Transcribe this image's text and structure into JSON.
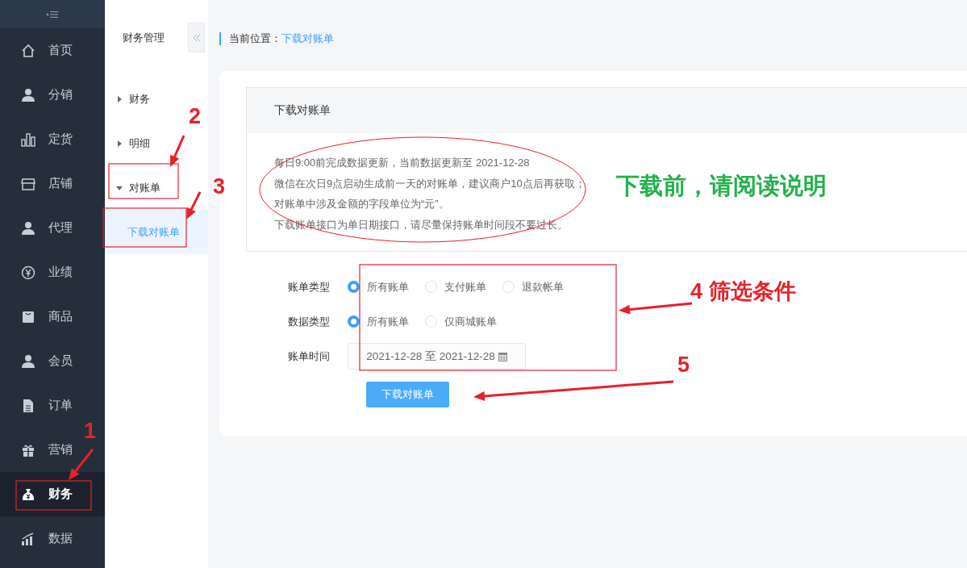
{
  "sidebar": {
    "items": [
      {
        "label": "首页",
        "selected": false
      },
      {
        "label": "分销",
        "selected": false
      },
      {
        "label": "定货",
        "selected": false
      },
      {
        "label": "店铺",
        "selected": false
      },
      {
        "label": "代理",
        "selected": false
      },
      {
        "label": "业绩",
        "selected": false
      },
      {
        "label": "商品",
        "selected": false
      },
      {
        "label": "会员",
        "selected": false
      },
      {
        "label": "订单",
        "selected": false
      },
      {
        "label": "营销",
        "selected": false
      },
      {
        "label": "财务",
        "selected": true
      },
      {
        "label": "数据",
        "selected": false
      }
    ]
  },
  "subnav": {
    "title": "财务管理",
    "tree": [
      {
        "label": "财务",
        "expanded": false,
        "selected": false
      },
      {
        "label": "明细",
        "expanded": false,
        "selected": false
      },
      {
        "label": "对账单",
        "expanded": true,
        "selected": false,
        "children": [
          {
            "label": "下载对账单",
            "selected": true
          }
        ]
      }
    ]
  },
  "breadcrumb": {
    "label": "当前位置：",
    "current": "下载对账单"
  },
  "panel": {
    "title": "下载对账单",
    "notes": [
      "每日9:00前完成数据更新，当前数据更新至 2021-12-28",
      "微信在次日9点启动生成前一天的对账单，建议商户10点后再获取；",
      "对账单中涉及金额的字段单位为“元”。",
      "下载账单接口为单日期接口，请尽量保持账单时间段不要过长。"
    ]
  },
  "form": {
    "rows": [
      {
        "label": "账单类型",
        "kind": "radio",
        "options": [
          {
            "label": "所有账单",
            "selected": true
          },
          {
            "label": "支付账单",
            "selected": false
          },
          {
            "label": "退款帐单",
            "selected": false
          }
        ]
      },
      {
        "label": "数据类型",
        "kind": "radio",
        "options": [
          {
            "label": "所有账单",
            "selected": true
          },
          {
            "label": "仅商城账单",
            "selected": false
          }
        ]
      },
      {
        "label": "账单时间",
        "kind": "daterange",
        "value": "2021-12-28 至 2021-12-28"
      }
    ],
    "button": "下载对账单"
  },
  "annotations": [
    {
      "kind": "red",
      "text": "1"
    },
    {
      "kind": "red",
      "text": "2"
    },
    {
      "kind": "red",
      "text": "3"
    },
    {
      "kind": "green",
      "text": "下载前，请阅读说明"
    },
    {
      "kind": "red",
      "text": "4 筛选条件"
    },
    {
      "kind": "red",
      "text": "5"
    }
  ]
}
